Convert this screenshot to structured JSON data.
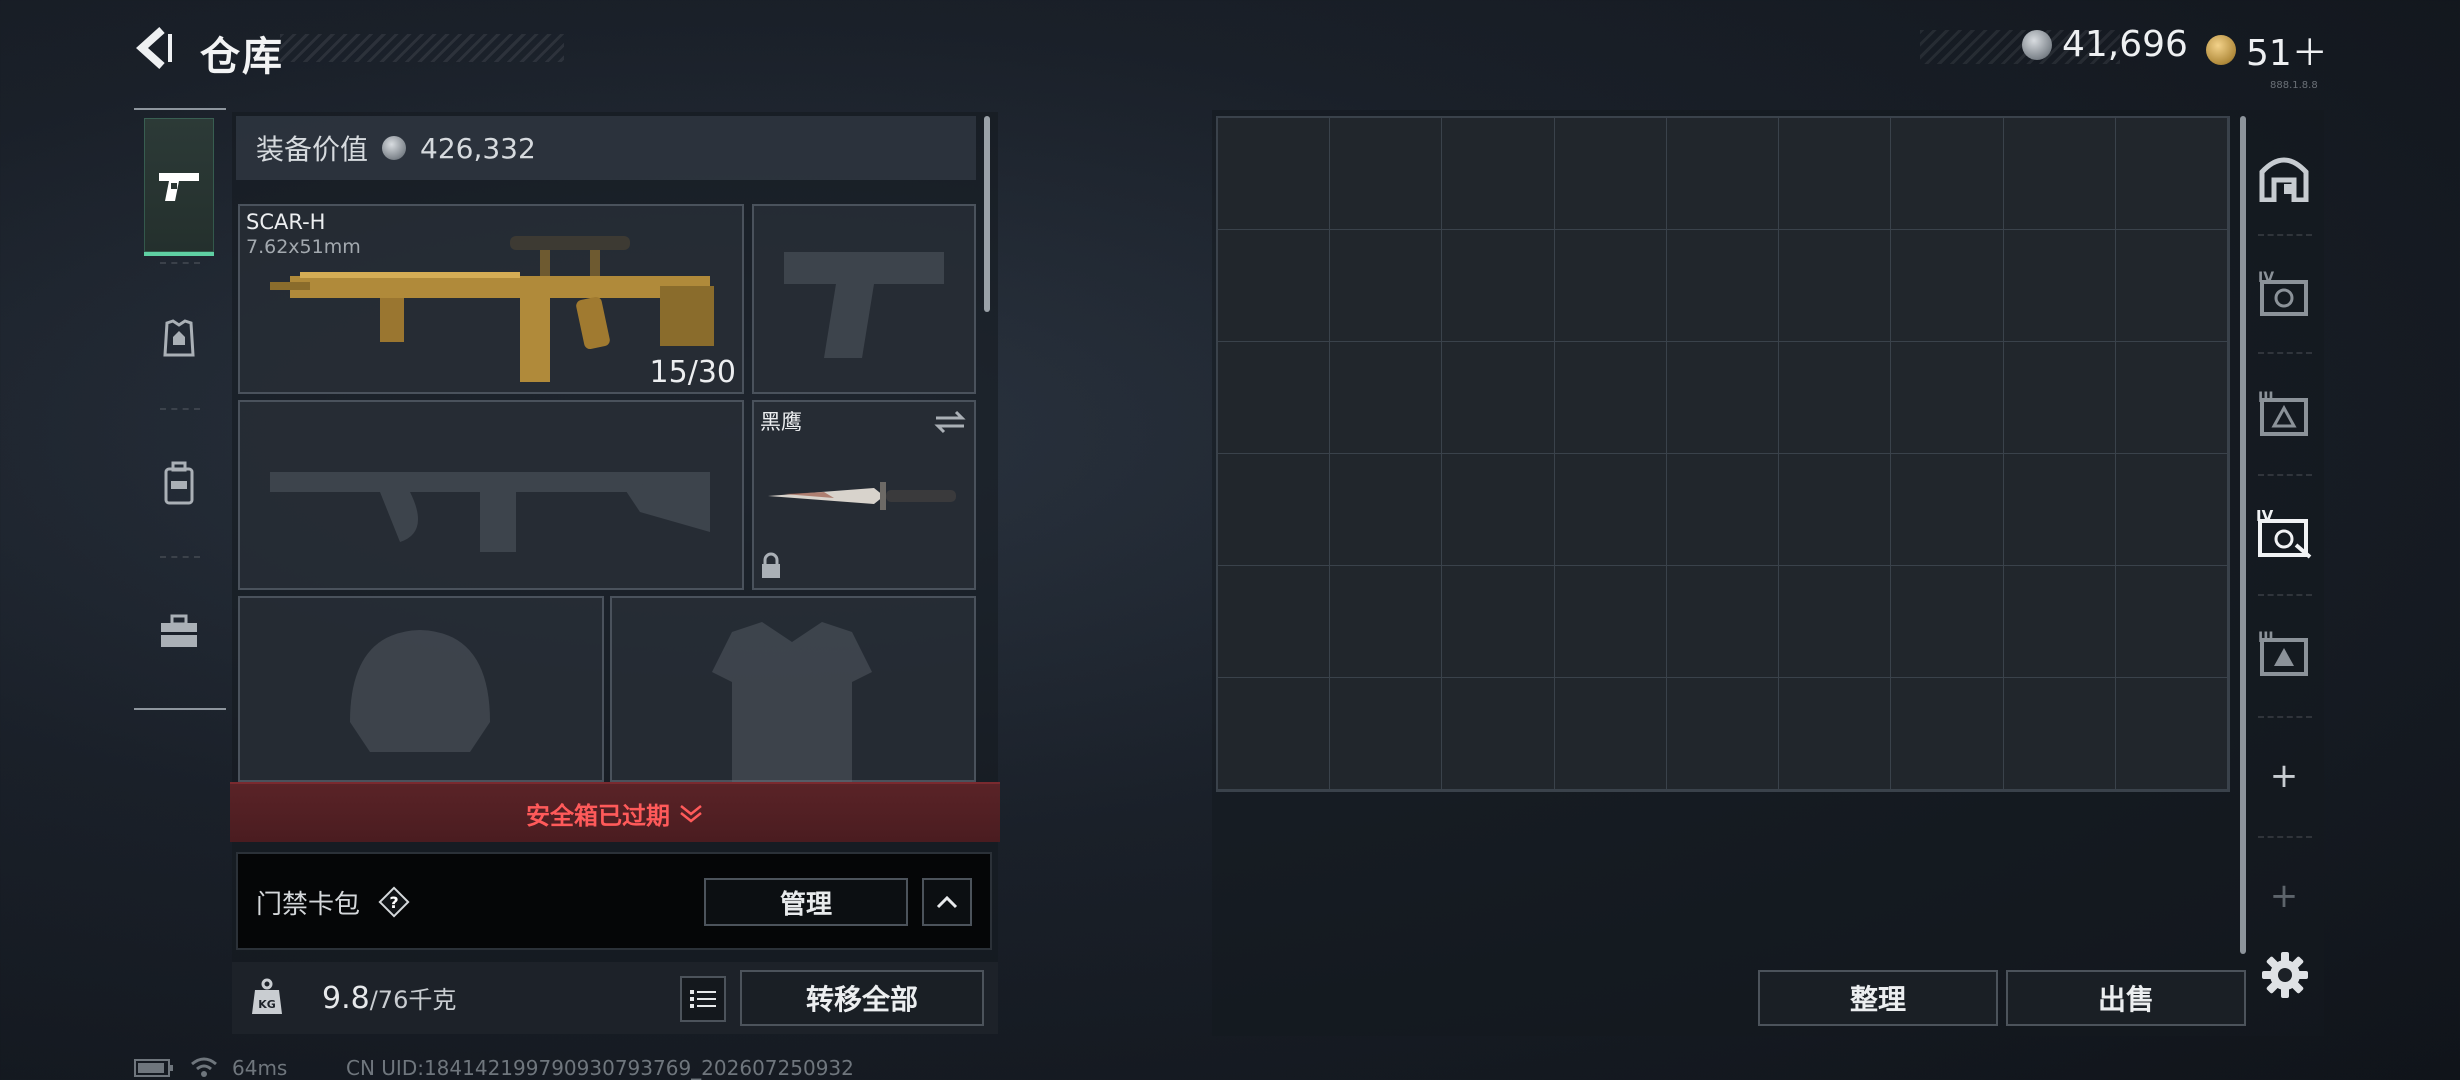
{
  "header": {
    "title": "仓库",
    "currency_silver": "41,696",
    "currency_gold": "51＋",
    "version": "888.1.8.8"
  },
  "loadout": {
    "value_label": "装备价值",
    "value": "426,332",
    "primary_weapon": {
      "name": "SCAR-H",
      "caliber": "7.62x51mm",
      "ammo": "15/30"
    },
    "melee": {
      "name": "黑鹰"
    },
    "safe_box_banner": "安全箱已过期",
    "keycard": {
      "label": "门禁卡包",
      "manage_label": "管理"
    },
    "weight": {
      "current": "9.8",
      "max": "/76千克"
    },
    "transfer_label": "转移全部"
  },
  "warehouse": {
    "columns": 9,
    "rows": 6,
    "sort_label": "整理",
    "sell_label": "出售"
  },
  "right_rail": {
    "items": [
      "storage-icon",
      "case-iv-icon",
      "case-iii-icon",
      "case-iv-active-icon",
      "case-iii-warning-icon"
    ]
  },
  "footer": {
    "ping": "64ms",
    "uid": "CN UID:184142199790930793769_202607250932"
  }
}
